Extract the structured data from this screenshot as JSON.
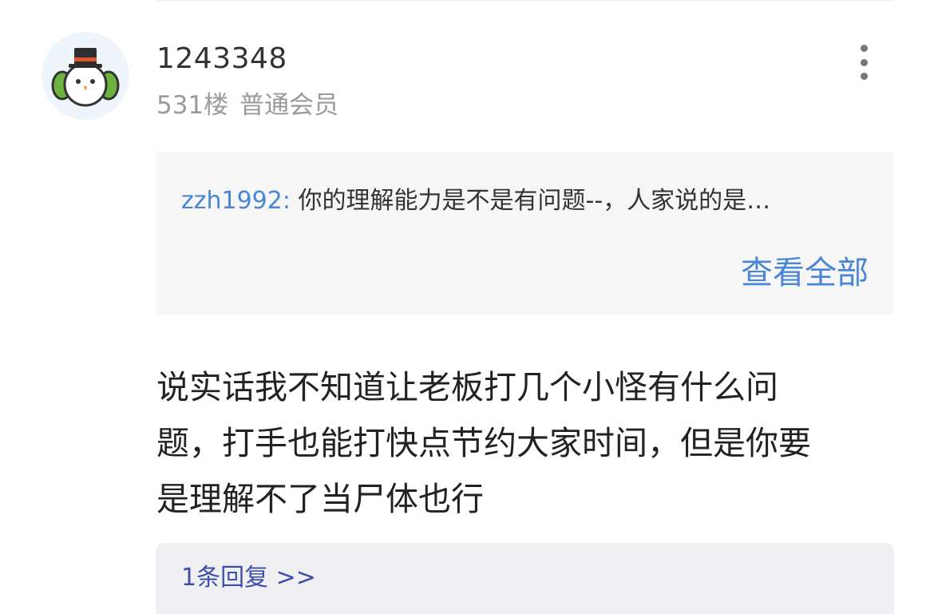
{
  "post": {
    "username": "1243348",
    "floor": "531楼",
    "member_level": "普通会员",
    "more_icon": "more-vertical-icon",
    "quote": {
      "author": "zzh1992:",
      "text": "你的理解能力是不是有问题--，人家说的是…",
      "view_all_label": "查看全部"
    },
    "content_lines": [
      "说实话我不知道让老板打几个小怪有什么问",
      "题，打手也能打快点节约大家时间，但是你要",
      "是理解不了当尸体也行"
    ],
    "reply_link": "1条回复 >>"
  },
  "colors": {
    "link_blue": "#4a86d6",
    "reply_blue": "#3d4fa8",
    "meta_gray": "#9a9a9a",
    "quote_bg": "#f6f6f6",
    "reply_bg": "#f0f0f2"
  }
}
